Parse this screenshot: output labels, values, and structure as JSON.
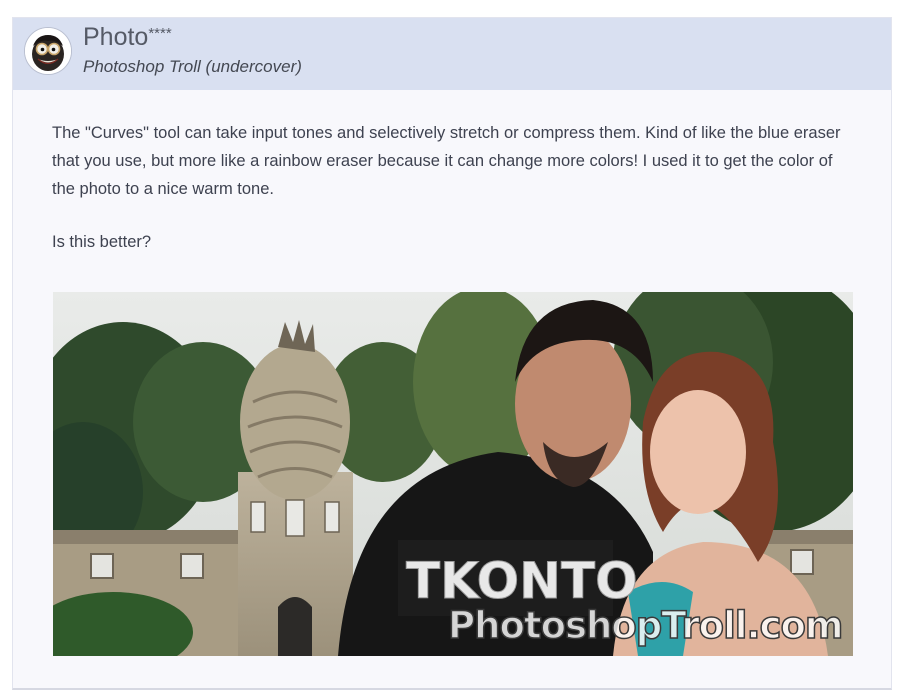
{
  "post": {
    "user_name": "Photo",
    "user_name_stars": "****",
    "user_title": "Photoshop Troll (undercover)",
    "body": "The \"Curves\" tool can take input tones and selectively stretch or compress them. Kind of like the blue eraser that you use, but more like a rainbow eraser because it can change more colors! I used it to get the color of the photo to a nice warm tone.",
    "question": "Is this better?",
    "image": {
      "shirt_text": "TKONTO",
      "watermark": "PhotoshopTroll.com"
    }
  },
  "colors": {
    "header_bg": "#d9e0f1",
    "card_bg": "#f8f8fc",
    "text": "#3e4250"
  }
}
